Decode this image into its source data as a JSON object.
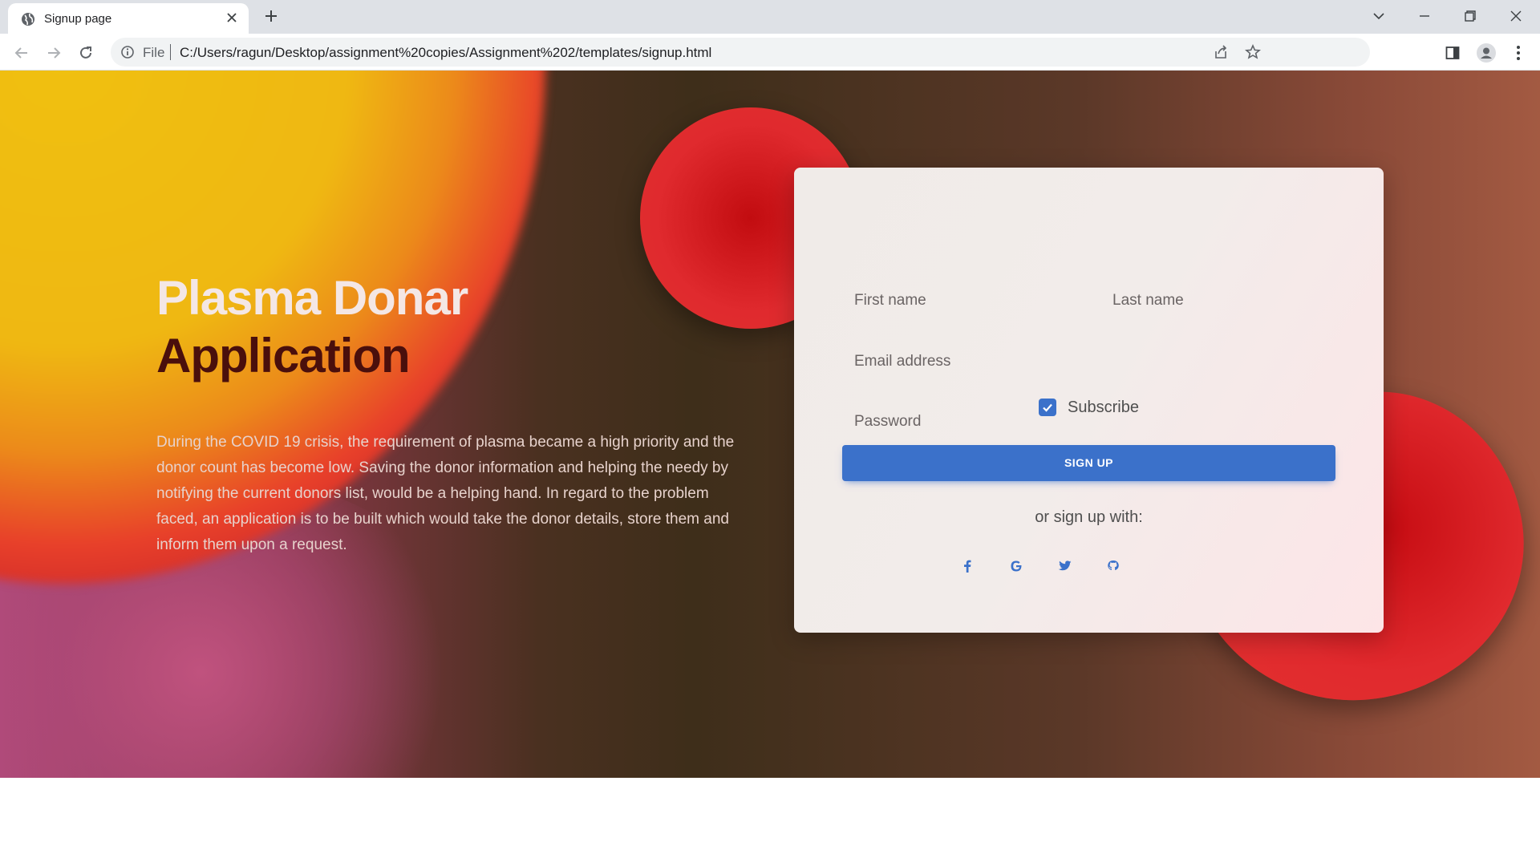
{
  "browser": {
    "tab_title": "Signup page",
    "url_scheme": "File",
    "url": "C:/Users/ragun/Desktop/assignment%20copies/Assignment%202/templates/signup.html"
  },
  "hero": {
    "title_line1": "Plasma Donar",
    "title_line2": "Application",
    "description": "During the COVID 19 crisis, the requirement of plasma became a high priority and the donor count has become low. Saving the donor information and helping the needy by notifying the current donors list, would be a helping hand. In regard to the problem faced, an application is to be built which would take the donor details, store them and inform them upon a request."
  },
  "form": {
    "first_name_label": "First name",
    "last_name_label": "Last name",
    "email_label": "Email address",
    "password_label": "Password",
    "subscribe_label": "Subscribe",
    "subscribe_checked": true,
    "signup_button": "SIGN UP",
    "or_text": "or sign up with:",
    "social_icons": [
      "facebook-icon",
      "google-icon",
      "twitter-icon",
      "github-icon"
    ]
  },
  "colors": {
    "accent": "#3b71ca",
    "title_light": "#f4e7e5",
    "title_dark": "#4a0f0c"
  }
}
